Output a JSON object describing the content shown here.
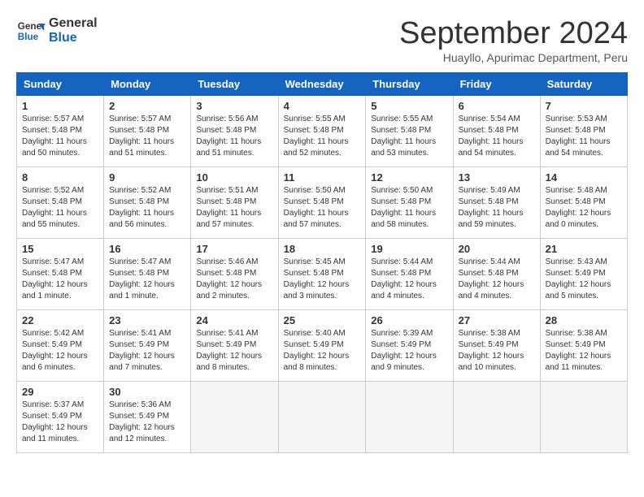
{
  "logo": {
    "line1": "General",
    "line2": "Blue"
  },
  "title": "September 2024",
  "location": "Huayllo, Apurimac Department, Peru",
  "weekdays": [
    "Sunday",
    "Monday",
    "Tuesday",
    "Wednesday",
    "Thursday",
    "Friday",
    "Saturday"
  ],
  "weeks": [
    [
      {
        "day": "1",
        "info": "Sunrise: 5:57 AM\nSunset: 5:48 PM\nDaylight: 11 hours\nand 50 minutes."
      },
      {
        "day": "2",
        "info": "Sunrise: 5:57 AM\nSunset: 5:48 PM\nDaylight: 11 hours\nand 51 minutes."
      },
      {
        "day": "3",
        "info": "Sunrise: 5:56 AM\nSunset: 5:48 PM\nDaylight: 11 hours\nand 51 minutes."
      },
      {
        "day": "4",
        "info": "Sunrise: 5:55 AM\nSunset: 5:48 PM\nDaylight: 11 hours\nand 52 minutes."
      },
      {
        "day": "5",
        "info": "Sunrise: 5:55 AM\nSunset: 5:48 PM\nDaylight: 11 hours\nand 53 minutes."
      },
      {
        "day": "6",
        "info": "Sunrise: 5:54 AM\nSunset: 5:48 PM\nDaylight: 11 hours\nand 54 minutes."
      },
      {
        "day": "7",
        "info": "Sunrise: 5:53 AM\nSunset: 5:48 PM\nDaylight: 11 hours\nand 54 minutes."
      }
    ],
    [
      {
        "day": "8",
        "info": "Sunrise: 5:52 AM\nSunset: 5:48 PM\nDaylight: 11 hours\nand 55 minutes."
      },
      {
        "day": "9",
        "info": "Sunrise: 5:52 AM\nSunset: 5:48 PM\nDaylight: 11 hours\nand 56 minutes."
      },
      {
        "day": "10",
        "info": "Sunrise: 5:51 AM\nSunset: 5:48 PM\nDaylight: 11 hours\nand 57 minutes."
      },
      {
        "day": "11",
        "info": "Sunrise: 5:50 AM\nSunset: 5:48 PM\nDaylight: 11 hours\nand 57 minutes."
      },
      {
        "day": "12",
        "info": "Sunrise: 5:50 AM\nSunset: 5:48 PM\nDaylight: 11 hours\nand 58 minutes."
      },
      {
        "day": "13",
        "info": "Sunrise: 5:49 AM\nSunset: 5:48 PM\nDaylight: 11 hours\nand 59 minutes."
      },
      {
        "day": "14",
        "info": "Sunrise: 5:48 AM\nSunset: 5:48 PM\nDaylight: 12 hours\nand 0 minutes."
      }
    ],
    [
      {
        "day": "15",
        "info": "Sunrise: 5:47 AM\nSunset: 5:48 PM\nDaylight: 12 hours\nand 1 minute."
      },
      {
        "day": "16",
        "info": "Sunrise: 5:47 AM\nSunset: 5:48 PM\nDaylight: 12 hours\nand 1 minute."
      },
      {
        "day": "17",
        "info": "Sunrise: 5:46 AM\nSunset: 5:48 PM\nDaylight: 12 hours\nand 2 minutes."
      },
      {
        "day": "18",
        "info": "Sunrise: 5:45 AM\nSunset: 5:48 PM\nDaylight: 12 hours\nand 3 minutes."
      },
      {
        "day": "19",
        "info": "Sunrise: 5:44 AM\nSunset: 5:48 PM\nDaylight: 12 hours\nand 4 minutes."
      },
      {
        "day": "20",
        "info": "Sunrise: 5:44 AM\nSunset: 5:48 PM\nDaylight: 12 hours\nand 4 minutes."
      },
      {
        "day": "21",
        "info": "Sunrise: 5:43 AM\nSunset: 5:49 PM\nDaylight: 12 hours\nand 5 minutes."
      }
    ],
    [
      {
        "day": "22",
        "info": "Sunrise: 5:42 AM\nSunset: 5:49 PM\nDaylight: 12 hours\nand 6 minutes."
      },
      {
        "day": "23",
        "info": "Sunrise: 5:41 AM\nSunset: 5:49 PM\nDaylight: 12 hours\nand 7 minutes."
      },
      {
        "day": "24",
        "info": "Sunrise: 5:41 AM\nSunset: 5:49 PM\nDaylight: 12 hours\nand 8 minutes."
      },
      {
        "day": "25",
        "info": "Sunrise: 5:40 AM\nSunset: 5:49 PM\nDaylight: 12 hours\nand 8 minutes."
      },
      {
        "day": "26",
        "info": "Sunrise: 5:39 AM\nSunset: 5:49 PM\nDaylight: 12 hours\nand 9 minutes."
      },
      {
        "day": "27",
        "info": "Sunrise: 5:38 AM\nSunset: 5:49 PM\nDaylight: 12 hours\nand 10 minutes."
      },
      {
        "day": "28",
        "info": "Sunrise: 5:38 AM\nSunset: 5:49 PM\nDaylight: 12 hours\nand 11 minutes."
      }
    ],
    [
      {
        "day": "29",
        "info": "Sunrise: 5:37 AM\nSunset: 5:49 PM\nDaylight: 12 hours\nand 11 minutes."
      },
      {
        "day": "30",
        "info": "Sunrise: 5:36 AM\nSunset: 5:49 PM\nDaylight: 12 hours\nand 12 minutes."
      },
      null,
      null,
      null,
      null,
      null
    ]
  ]
}
